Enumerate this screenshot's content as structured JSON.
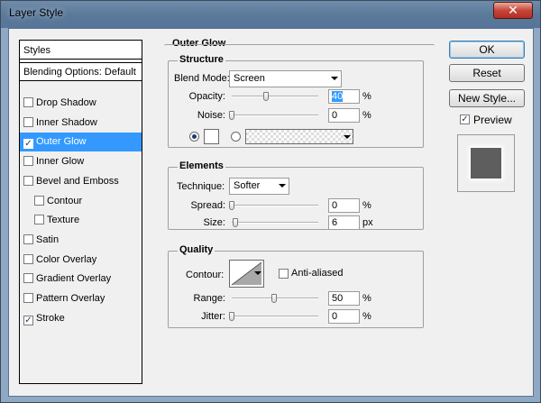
{
  "window": {
    "title": "Layer Style",
    "close_glyph": "✕"
  },
  "styles_panel": {
    "header": "Styles",
    "blending_options": "Blending Options: Default",
    "items": [
      {
        "label": "Drop Shadow",
        "checked": false,
        "selected": false
      },
      {
        "label": "Inner Shadow",
        "checked": false,
        "selected": false
      },
      {
        "label": "Outer Glow",
        "checked": true,
        "selected": true
      },
      {
        "label": "Inner Glow",
        "checked": false,
        "selected": false
      },
      {
        "label": "Bevel and Emboss",
        "checked": false,
        "selected": false
      },
      {
        "label": "Contour",
        "checked": false,
        "selected": false,
        "sub": true
      },
      {
        "label": "Texture",
        "checked": false,
        "selected": false,
        "sub": true
      },
      {
        "label": "Satin",
        "checked": false,
        "selected": false
      },
      {
        "label": "Color Overlay",
        "checked": false,
        "selected": false
      },
      {
        "label": "Gradient Overlay",
        "checked": false,
        "selected": false
      },
      {
        "label": "Pattern Overlay",
        "checked": false,
        "selected": false
      },
      {
        "label": "Stroke",
        "checked": true,
        "selected": false
      }
    ]
  },
  "outer_glow": {
    "title": "Outer Glow",
    "structure": {
      "title": "Structure",
      "blend_mode_label": "Blend Mode:",
      "blend_mode_value": "Screen",
      "opacity_label": "Opacity:",
      "opacity_value": "40",
      "opacity_unit": "%",
      "noise_label": "Noise:",
      "noise_value": "0",
      "noise_unit": "%",
      "color_mode": "solid",
      "glow_color": "#ffffff"
    },
    "elements": {
      "title": "Elements",
      "technique_label": "Technique:",
      "technique_value": "Softer",
      "spread_label": "Spread:",
      "spread_value": "0",
      "spread_unit": "%",
      "size_label": "Size:",
      "size_value": "6",
      "size_unit": "px"
    },
    "quality": {
      "title": "Quality",
      "contour_label": "Contour:",
      "anti_aliased_label": "Anti-aliased",
      "anti_aliased_checked": false,
      "range_label": "Range:",
      "range_value": "50",
      "range_unit": "%",
      "jitter_label": "Jitter:",
      "jitter_value": "0",
      "jitter_unit": "%"
    }
  },
  "buttons": {
    "ok": "OK",
    "reset": "Reset",
    "new_style": "New Style...",
    "preview_label": "Preview",
    "preview_checked": true
  },
  "colors": {
    "selection": "#3399ff",
    "preview_swatch": "#5e5e5e"
  }
}
